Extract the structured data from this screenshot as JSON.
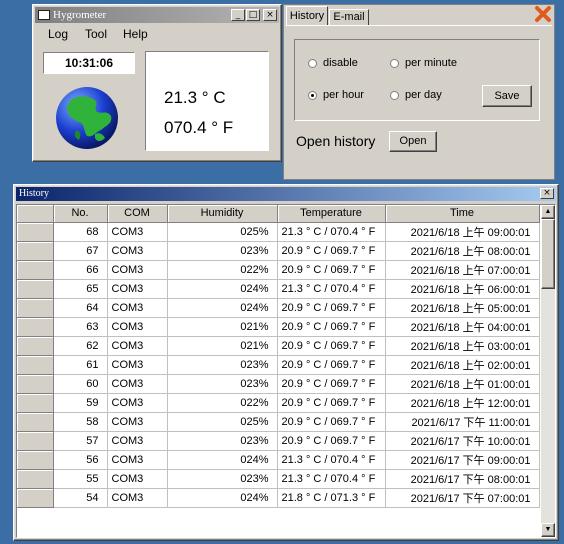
{
  "hygrometer": {
    "title": "Hygrometer",
    "menu": [
      "Log",
      "Tool",
      "Help"
    ],
    "time": "10:31:06",
    "temp_c": "21.3 ° C",
    "temp_f": "070.4 ° F"
  },
  "settings": {
    "tabs": [
      "History",
      "E-mail"
    ],
    "radio": [
      {
        "label": "disable",
        "selected": false
      },
      {
        "label": "per minute",
        "selected": false
      },
      {
        "label": "per hour",
        "selected": true
      },
      {
        "label": "per day",
        "selected": false
      }
    ],
    "save_label": "Save",
    "open_history_label": "Open history",
    "open_label": "Open",
    "close_color": "#e05a1a"
  },
  "history": {
    "title": "History",
    "columns": [
      "No.",
      "COM",
      "Humidity",
      "Temperature",
      "Time"
    ],
    "rows": [
      [
        "68",
        "COM3",
        "025%",
        "21.3 ° C / 070.4 ° F",
        "2021/6/18 上午 09:00:01"
      ],
      [
        "67",
        "COM3",
        "023%",
        "20.9 ° C / 069.7 ° F",
        "2021/6/18 上午 08:00:01"
      ],
      [
        "66",
        "COM3",
        "022%",
        "20.9 ° C / 069.7 ° F",
        "2021/6/18 上午 07:00:01"
      ],
      [
        "65",
        "COM3",
        "024%",
        "21.3 ° C / 070.4 ° F",
        "2021/6/18 上午 06:00:01"
      ],
      [
        "64",
        "COM3",
        "024%",
        "20.9 ° C / 069.7 ° F",
        "2021/6/18 上午 05:00:01"
      ],
      [
        "63",
        "COM3",
        "021%",
        "20.9 ° C / 069.7 ° F",
        "2021/6/18 上午 04:00:01"
      ],
      [
        "62",
        "COM3",
        "021%",
        "20.9 ° C / 069.7 ° F",
        "2021/6/18 上午 03:00:01"
      ],
      [
        "61",
        "COM3",
        "023%",
        "20.9 ° C / 069.7 ° F",
        "2021/6/18 上午 02:00:01"
      ],
      [
        "60",
        "COM3",
        "023%",
        "20.9 ° C / 069.7 ° F",
        "2021/6/18 上午 01:00:01"
      ],
      [
        "59",
        "COM3",
        "022%",
        "20.9 ° C / 069.7 ° F",
        "2021/6/18 上午 12:00:01"
      ],
      [
        "58",
        "COM3",
        "025%",
        "20.9 ° C / 069.7 ° F",
        "2021/6/17 下午 11:00:01"
      ],
      [
        "57",
        "COM3",
        "023%",
        "20.9 ° C / 069.7 ° F",
        "2021/6/17 下午 10:00:01"
      ],
      [
        "56",
        "COM3",
        "024%",
        "21.3 ° C / 070.4 ° F",
        "2021/6/17 下午 09:00:01"
      ],
      [
        "55",
        "COM3",
        "023%",
        "21.3 ° C / 070.4 ° F",
        "2021/6/17 下午 08:00:01"
      ],
      [
        "54",
        "COM3",
        "024%",
        "21.8 ° C / 071.3 ° F",
        "2021/6/17 下午 07:00:01"
      ]
    ]
  }
}
